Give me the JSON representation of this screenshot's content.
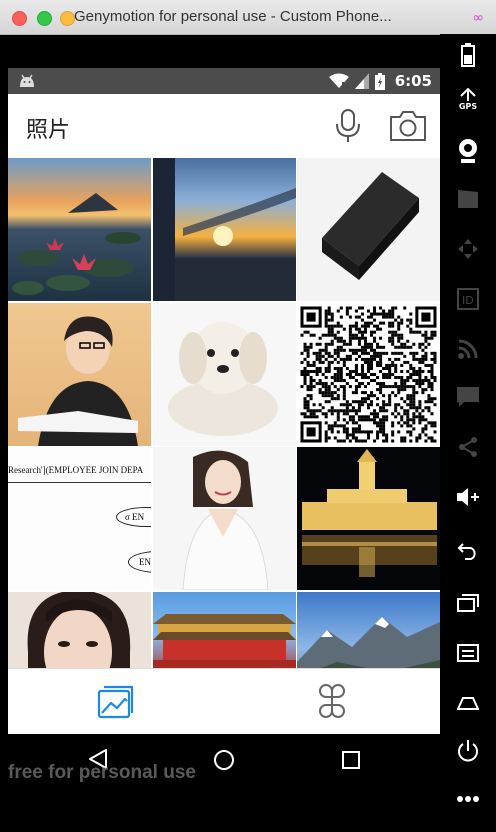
{
  "window": {
    "title": "Genymotion for personal use - Custom Phone...",
    "watermark": "free for personal use"
  },
  "statusbar": {
    "time": "6:05"
  },
  "appbar": {
    "title": "照片",
    "mic_icon": "microphone-icon",
    "camera_icon": "camera-icon"
  },
  "photos": [
    {
      "name": "lotus-pond-sunset-photo"
    },
    {
      "name": "sunset-window-photo"
    },
    {
      "name": "phone-box-photo"
    },
    {
      "name": "student-reading-photo"
    },
    {
      "name": "white-puppy-photo"
    },
    {
      "name": "qr-code-photo"
    },
    {
      "name": "employee-document-photo",
      "text": "Research'](EMPLOYEE JOIN DEPA",
      "text2": "σ EN",
      "text3": "EN"
    },
    {
      "name": "bride-portrait-photo"
    },
    {
      "name": "night-building-photo"
    },
    {
      "name": "woman-portrait-photo"
    },
    {
      "name": "tiananmen-photo"
    },
    {
      "name": "mountains-photo"
    }
  ],
  "bottomnav": {
    "gallery_icon": "gallery-icon",
    "clover_icon": "clover-icon"
  },
  "sidebar": {
    "gps_label": "GPS"
  },
  "colors": {
    "accent": "#1e88e5",
    "statusbar": "#4c4c4c"
  }
}
